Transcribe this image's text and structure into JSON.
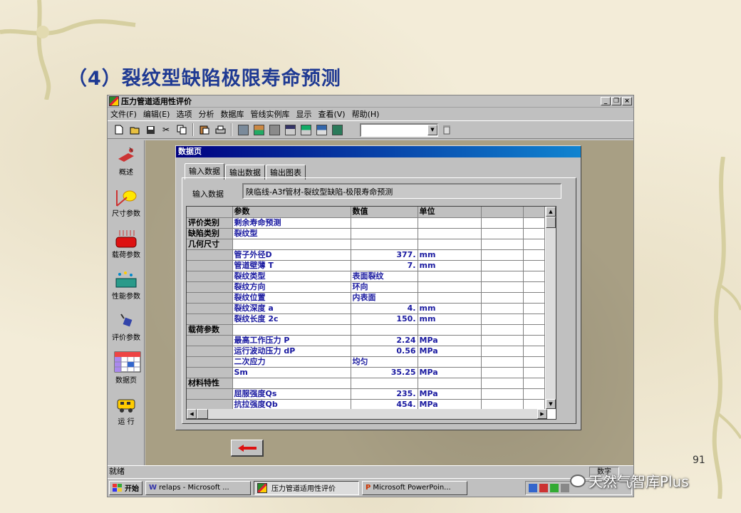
{
  "slide": {
    "title": "（4）裂纹型缺陷极限寿命预测",
    "page_number": "91",
    "watermark": "天然气智库Plus"
  },
  "window": {
    "title": "压力管道适用性评价",
    "controls": [
      "_",
      "❐",
      "×"
    ]
  },
  "menu": [
    "文件(F)",
    "编辑(E)",
    "选项",
    "分析",
    "数据库",
    "管线实例库",
    "显示",
    "查看(V)",
    "帮助(H)"
  ],
  "toolbar": {
    "icons": [
      "new-icon",
      "open-icon",
      "save-icon",
      "cut-icon",
      "copy-icon",
      "paste-icon",
      "print-icon",
      "view1-icon",
      "view2-icon",
      "view3-icon",
      "view4-icon",
      "view5-icon",
      "view6-icon",
      "view7-icon"
    ],
    "combo_value": ""
  },
  "sidebar": [
    {
      "label": "概述",
      "icon": "overview-icon"
    },
    {
      "label": "尺寸参数",
      "icon": "dimension-icon"
    },
    {
      "label": "载荷参数",
      "icon": "load-icon"
    },
    {
      "label": "性能参数",
      "icon": "performance-icon"
    },
    {
      "label": "评价参数",
      "icon": "evaluation-icon"
    },
    {
      "label": "数据页",
      "icon": "datapage-icon"
    },
    {
      "label": "运 行",
      "icon": "run-icon"
    }
  ],
  "dialog": {
    "title": "数据页",
    "tabs": [
      "输入数据",
      "输出数据",
      "输出图表"
    ],
    "active_tab": "输入数据",
    "input_label": "输入数据",
    "input_value": "陕临线-A3f管材-裂纹型缺陷-极限寿命预测",
    "grid": {
      "headers": [
        "",
        "参数",
        "数值",
        "单位",
        "",
        ""
      ],
      "rows": [
        [
          "评价类别",
          "剩余寿命预测",
          "",
          "",
          "",
          ""
        ],
        [
          "缺陷类别",
          "裂纹型",
          "",
          "",
          "",
          ""
        ],
        [
          "几何尺寸",
          "",
          "",
          "",
          "",
          ""
        ],
        [
          "",
          "管子外径D",
          "377.",
          "mm",
          "",
          ""
        ],
        [
          "",
          "管道壁薄 T",
          "7.",
          "mm",
          "",
          ""
        ],
        [
          "",
          "裂纹类型",
          "表面裂纹",
          "",
          "",
          ""
        ],
        [
          "",
          "裂纹方向",
          "环向",
          "",
          "",
          ""
        ],
        [
          "",
          "裂纹位置",
          "内表面",
          "",
          "",
          ""
        ],
        [
          "",
          "裂纹深度 a",
          "4.",
          "mm",
          "",
          ""
        ],
        [
          "",
          "裂纹长度 2c",
          "150.",
          "mm",
          "",
          ""
        ],
        [
          "载荷参数",
          "",
          "",
          "",
          "",
          ""
        ],
        [
          "",
          "最高工作压力 P",
          "2.24",
          "MPa",
          "",
          ""
        ],
        [
          "",
          "运行波动压力 dP",
          "0.56",
          "MPa",
          "",
          ""
        ],
        [
          "",
          "二次应力",
          "均匀",
          "",
          "",
          ""
        ],
        [
          "",
          "Sm",
          "35.25",
          "MPa",
          "",
          ""
        ],
        [
          "材料特性",
          "",
          "",
          "",
          "",
          ""
        ],
        [
          "",
          "屈服强度Qs",
          "235.",
          "MPa",
          "",
          ""
        ],
        [
          "",
          "抗拉强度Qb",
          "454.",
          "MPa",
          "",
          ""
        ]
      ]
    }
  },
  "statusbar": {
    "text": "就绪",
    "right": "数字"
  },
  "taskbar": {
    "start": "开始",
    "tasks": [
      "relaps - Microsoft ...",
      "压力管道适用性评价",
      "Microsoft PowerPoin..."
    ],
    "active_index": 1
  }
}
